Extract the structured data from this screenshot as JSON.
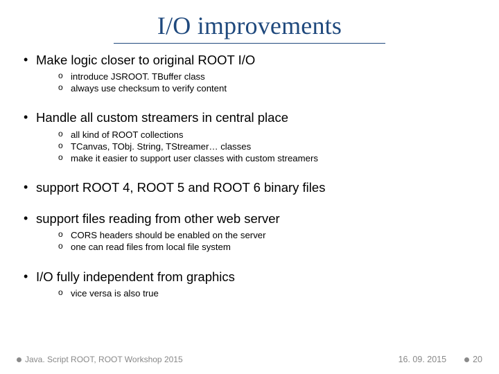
{
  "title": "I/O improvements",
  "bullets": [
    {
      "text": "Make logic closer to original ROOT I/O",
      "sub": [
        "introduce JSROOT. TBuffer class",
        "always use checksum to verify content"
      ]
    },
    {
      "text": "Handle all custom streamers in central place",
      "sub": [
        "all kind of ROOT collections",
        "TCanvas, TObj. String, TStreamer… classes",
        "make it easier to support user classes with custom streamers"
      ]
    },
    {
      "text": "support ROOT 4, ROOT 5 and ROOT 6 binary files",
      "sub": []
    },
    {
      "text": "support files reading from other web server",
      "sub": [
        "CORS headers should be enabled on the server",
        "one can read files from local file system"
      ]
    },
    {
      "text": "I/O fully independent from graphics",
      "sub": [
        "vice versa is also true"
      ]
    }
  ],
  "footer": {
    "left": "Java. Script ROOT, ROOT Workshop 2015",
    "date": "16. 09. 2015",
    "page": "20"
  }
}
